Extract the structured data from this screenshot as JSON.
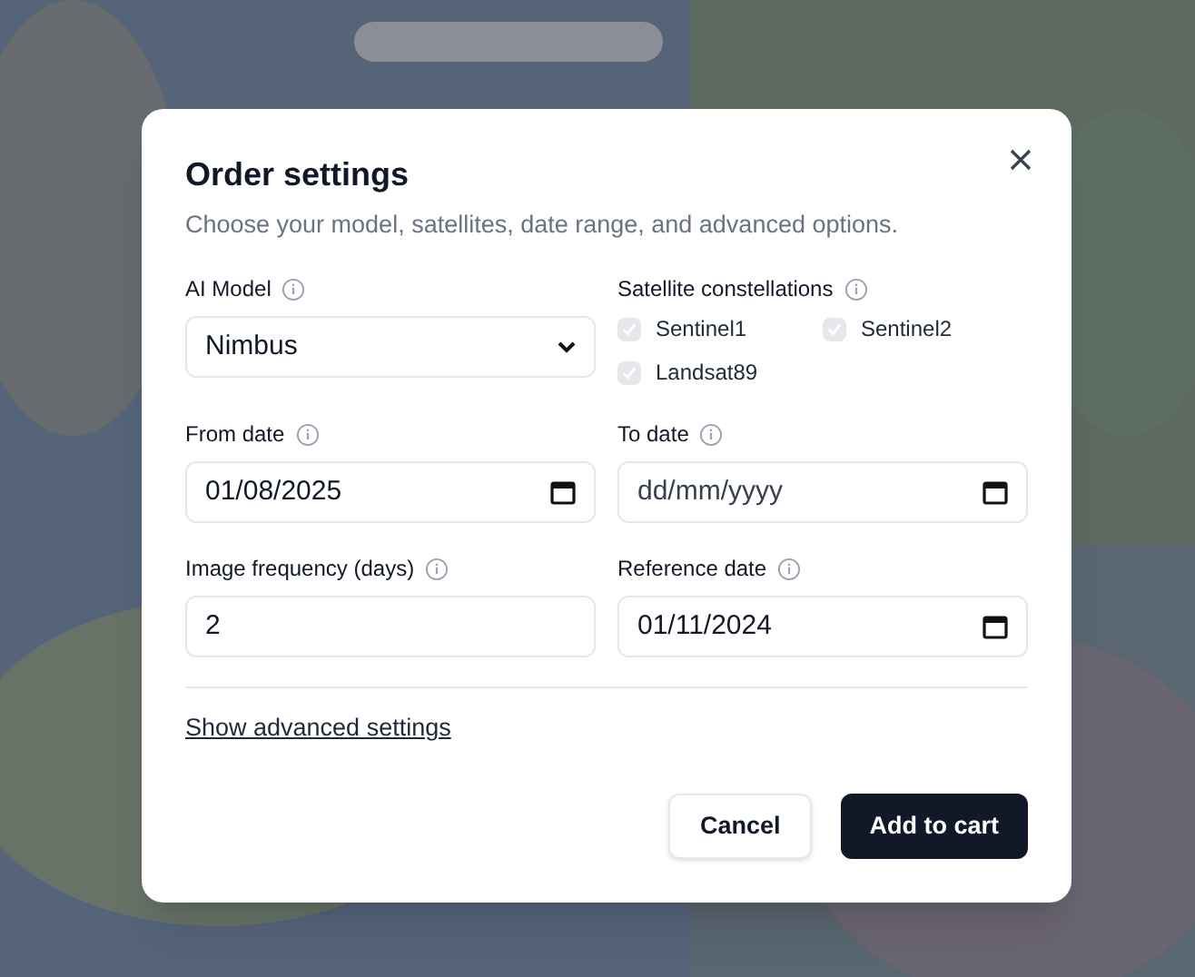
{
  "dialog": {
    "title": "Order settings",
    "description": "Choose your model, satellites, date range, and advanced options.",
    "model": {
      "label": "AI Model",
      "kind": "select",
      "value": "Nimbus"
    },
    "constellations": {
      "label": "Satellite constellations",
      "options": [
        {
          "label": "Sentinel1",
          "checked": true,
          "disabled": true
        },
        {
          "label": "Sentinel2",
          "checked": true,
          "disabled": true
        },
        {
          "label": "Landsat89",
          "checked": true,
          "disabled": true
        }
      ]
    },
    "fields": [
      {
        "label": "From date",
        "kind": "date",
        "value": "01/08/2025"
      },
      {
        "label": "To date",
        "kind": "date",
        "placeholder": "dd/mm/yyyy"
      },
      {
        "label": "Image frequency (days)",
        "kind": "number",
        "value": "2"
      },
      {
        "label": "Reference date",
        "kind": "date",
        "value": "01/11/2024"
      }
    ],
    "advanced_link": "Show advanced settings",
    "buttons": [
      {
        "label": "Cancel",
        "kind": "secondary"
      },
      {
        "label": "Add to cart",
        "kind": "primary"
      }
    ]
  }
}
